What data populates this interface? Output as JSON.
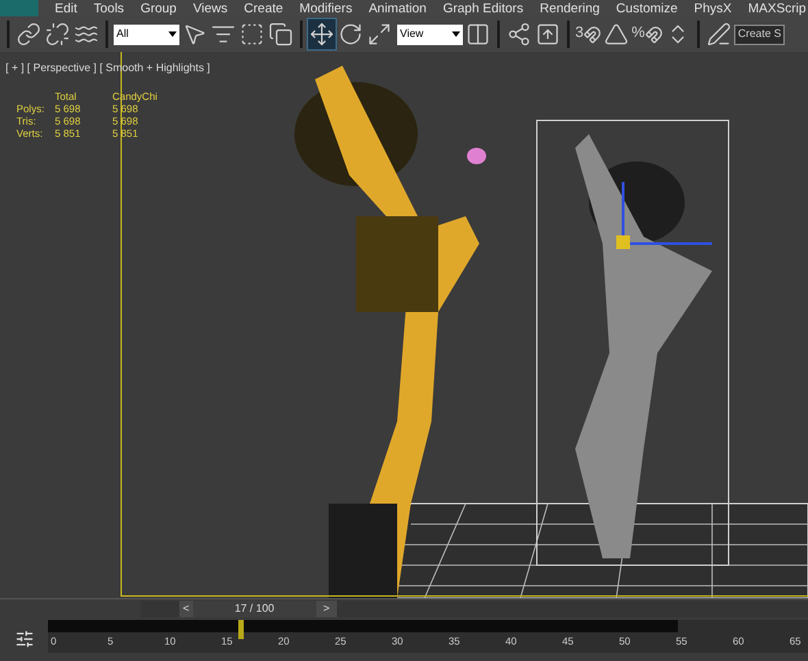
{
  "menu": [
    "Edit",
    "Tools",
    "Group",
    "Views",
    "Create",
    "Modifiers",
    "Animation",
    "Graph Editors",
    "Rendering",
    "Customize",
    "PhysX",
    "MAXScrip"
  ],
  "toolbar": {
    "filter": "All",
    "coordinate_system": "View",
    "snap_toggle": "3",
    "percent_snap": "%",
    "named_selection": "Create S",
    "transform_tools": [
      {
        "kind": "move",
        "selected": true
      },
      {
        "kind": "rotate",
        "selected": false
      },
      {
        "kind": "scale",
        "selected": false
      }
    ]
  },
  "viewport": {
    "labels": "[ + ] [ Perspective ] [ Smooth + Highlights ]",
    "stats": {
      "columns": [
        "Total",
        "CandyChi"
      ],
      "rows": [
        {
          "label": "Polys:",
          "values": [
            "5 698",
            "5 698"
          ]
        },
        {
          "label": "Tris:",
          "values": [
            "5 698",
            "5 698"
          ]
        },
        {
          "label": "Verts:",
          "values": [
            "5 851",
            "5 851"
          ]
        }
      ]
    }
  },
  "time_slider": {
    "prev": "<",
    "frame": "17 / 100",
    "next": ">",
    "level": 0.17
  },
  "track_bar": {
    "level": 0.25,
    "ticks": [
      "0",
      "5",
      "10",
      "15",
      "20",
      "25",
      "30",
      "35",
      "40",
      "45",
      "50",
      "55",
      "60",
      "65"
    ]
  }
}
